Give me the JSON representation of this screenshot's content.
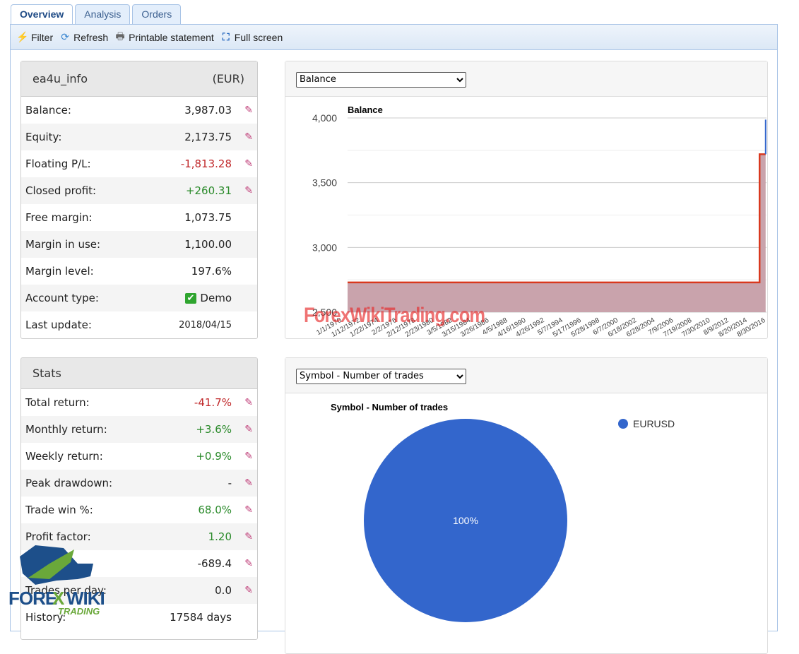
{
  "tabs": [
    {
      "label": "Overview",
      "active": true
    },
    {
      "label": "Analysis"
    },
    {
      "label": "Orders"
    }
  ],
  "toolbar": {
    "filter": "Filter",
    "refresh": "Refresh",
    "print": "Printable statement",
    "fullscreen": "Full screen"
  },
  "account": {
    "name": "ea4u_info",
    "currency": "(EUR)",
    "rows": [
      {
        "label": "Balance:",
        "value": "3,987.03",
        "chart": true
      },
      {
        "label": "Equity:",
        "value": "2,173.75",
        "chart": true
      },
      {
        "label": "Floating P/L:",
        "value": "-1,813.28",
        "tone": "neg",
        "chart": true
      },
      {
        "label": "Closed profit:",
        "value": "+260.31",
        "tone": "pos",
        "chart": true
      },
      {
        "label": "Free margin:",
        "value": "1,073.75"
      },
      {
        "label": "Margin in use:",
        "value": "1,100.00"
      },
      {
        "label": "Margin level:",
        "value": "197.6%"
      },
      {
        "label": "Account type:",
        "value": "Demo",
        "check": true
      },
      {
        "label": "Last update:",
        "value": "2018/04/15",
        "small": true
      }
    ]
  },
  "stats": {
    "title": "Stats",
    "rows": [
      {
        "label": "Total return:",
        "value": "-41.7%",
        "tone": "neg",
        "chart": true
      },
      {
        "label": "Monthly return:",
        "value": "+3.6%",
        "tone": "pos",
        "chart": true
      },
      {
        "label": "Weekly return:",
        "value": "+0.9%",
        "tone": "pos",
        "chart": true
      },
      {
        "label": "Peak drawdown:",
        "value": "-",
        "chart": true
      },
      {
        "label": "Trade win %:",
        "value": "68.0%",
        "tone": "pos",
        "chart": true
      },
      {
        "label": "Profit factor:",
        "value": "1.20",
        "tone": "pos",
        "chart": true
      },
      {
        "label": "Pips:",
        "value": "-689.4",
        "chart": true
      },
      {
        "label": "Trades per day:",
        "value": "0.0",
        "chart": true
      },
      {
        "label": "History:",
        "value": "17584 days"
      }
    ]
  },
  "chart_data": [
    {
      "type": "area",
      "title": "Balance",
      "select": "Balance",
      "ylim": [
        2500,
        4000
      ],
      "yticks": [
        2500,
        3000,
        3500,
        4000
      ],
      "ytick_labels": [
        "2,500",
        "3,000",
        "3,500",
        "4,000"
      ],
      "xtick_labels": [
        "1/1/1970",
        "1/12/1972",
        "1/22/1974",
        "2/2/1976",
        "2/12/1978",
        "2/23/1980",
        "3/5/1982",
        "3/15/1984",
        "3/26/1986",
        "4/5/1988",
        "4/16/1990",
        "4/26/1992",
        "5/7/1994",
        "5/17/1996",
        "5/28/1998",
        "6/7/2000",
        "6/18/2002",
        "6/28/2004",
        "7/9/2006",
        "7/19/2008",
        "7/30/2010",
        "8/9/2012",
        "8/20/2014",
        "8/30/2016"
      ],
      "series": [
        {
          "x": [
            1970,
            2017.6,
            2017.6,
            2018.3
          ],
          "y": [
            2730,
            2730,
            3720,
            3720
          ],
          "color": "#d9381e"
        },
        {
          "x": [
            2018.3,
            2018.3
          ],
          "y": [
            3720,
            3987
          ],
          "color": "#3366cc"
        }
      ],
      "grid": true
    },
    {
      "type": "pie",
      "title": "Symbol - Number of trades",
      "select": "Symbol - Number of trades",
      "slices": [
        {
          "label": "EURUSD",
          "value": 100,
          "display": "100%",
          "color": "#3366cc"
        }
      ],
      "legend": "right"
    }
  ],
  "watermark": "ForexWikiTrading.com",
  "logo": {
    "line1": "FOREX WIKI",
    "line2": "TRADING"
  }
}
